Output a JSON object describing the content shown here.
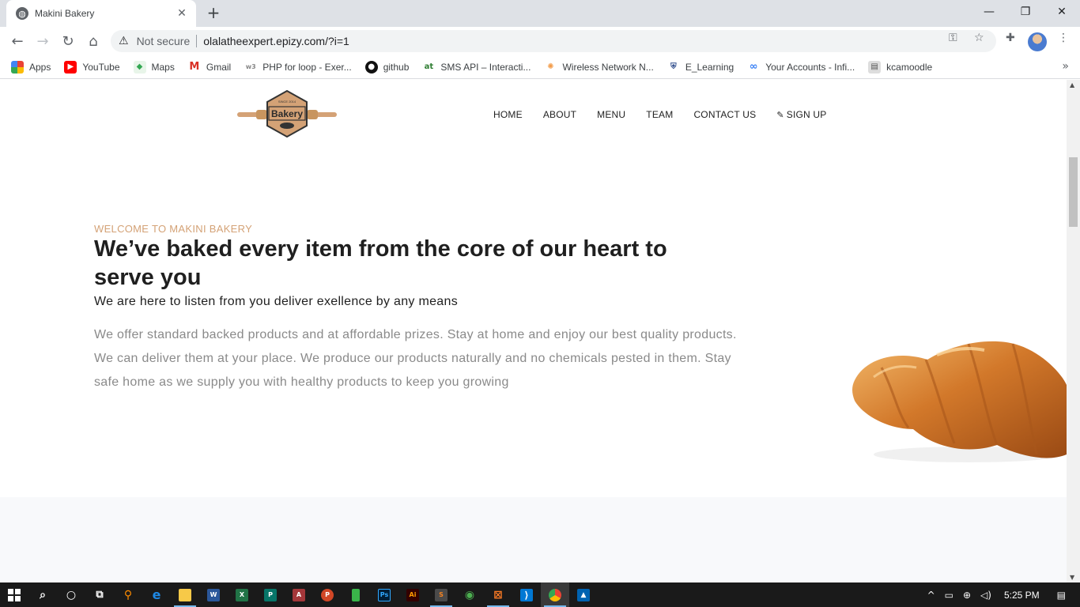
{
  "browser": {
    "tab_title": "Makini Bakery",
    "security_label": "Not secure",
    "url": "olalatheexpert.epizy.com/?i=1",
    "bookmarks": [
      {
        "label": "Apps",
        "icon": "apps-grid-icon",
        "color": "#e8453c"
      },
      {
        "label": "YouTube",
        "icon": "youtube-icon",
        "color": "#ff0000"
      },
      {
        "label": "Maps",
        "icon": "maps-icon",
        "color": "#34a853"
      },
      {
        "label": "Gmail",
        "icon": "gmail-icon",
        "color": "#d93025"
      },
      {
        "label": "PHP for loop - Exer...",
        "icon": "w3schools-icon",
        "color": "#888888"
      },
      {
        "label": "github",
        "icon": "github-icon",
        "color": "#111111"
      },
      {
        "label": "SMS API – Interacti...",
        "icon": "africastalking-icon",
        "color": "#f59c00"
      },
      {
        "label": "Wireless Network N...",
        "icon": "spinner-icon",
        "color": "#f39c4a"
      },
      {
        "label": "E_Learning",
        "icon": "shield-icon",
        "color": "#2c4a8a"
      },
      {
        "label": "Your Accounts - Infi...",
        "icon": "infinity-icon",
        "color": "#3b82f6"
      },
      {
        "label": "kcamoodle",
        "icon": "moodle-icon",
        "color": "#777777"
      }
    ]
  },
  "site": {
    "logo_text": "Bakery",
    "logo_since": "SINCE 2014",
    "nav": [
      "HOME",
      "ABOUT",
      "MENU",
      "TEAM",
      "CONTACT US"
    ],
    "signup_label": "SIGN UP",
    "hero": {
      "welcome": "WELCOME TO MAKINI BAKERY",
      "headline": "We’ve baked every item from the core of our heart to serve you",
      "subline": "We are here to listen from you deliver exellence by any means",
      "body": "We offer standard backed products and at affordable prizes. Stay at home and enjoy our best quality products. We can deliver them at your place. We produce our products naturally and no chemicals pested in them. Stay safe home as we supply you with healthy products to keep you growing"
    },
    "accent_color": "#d4a276"
  },
  "taskbar": {
    "time": "5:25 PM",
    "apps": [
      {
        "name": "search-icon",
        "color": "#1a1a1a",
        "glyph": "⌕"
      },
      {
        "name": "cortana-icon",
        "color": "#1a1a1a",
        "glyph": "○"
      },
      {
        "name": "task-view-icon",
        "color": "#1a1a1a",
        "glyph": "⧉"
      },
      {
        "name": "search-everything-icon",
        "color": "#ff8c00",
        "glyph": "⚲"
      },
      {
        "name": "edge-icon",
        "color": "#1e88e5",
        "glyph": "e"
      },
      {
        "name": "file-explorer-icon",
        "color": "#f7c948",
        "glyph": "▬"
      },
      {
        "name": "word-icon",
        "color": "#2b579a",
        "glyph": "W"
      },
      {
        "name": "excel-icon",
        "color": "#217346",
        "glyph": "X"
      },
      {
        "name": "publisher-icon",
        "color": "#077568",
        "glyph": "P"
      },
      {
        "name": "access-icon",
        "color": "#a4373a",
        "glyph": "A"
      },
      {
        "name": "powerpoint-icon",
        "color": "#d24726",
        "glyph": "P"
      },
      {
        "name": "green-app-icon",
        "color": "#3ab54a",
        "glyph": "▮"
      },
      {
        "name": "photoshop-icon",
        "color": "#001e36",
        "glyph": "Ps"
      },
      {
        "name": "illustrator-icon",
        "color": "#330000",
        "glyph": "Ai"
      },
      {
        "name": "sublime-icon",
        "color": "#f58220",
        "glyph": "S"
      },
      {
        "name": "greenshot-icon",
        "color": "#2e7d32",
        "glyph": "◉"
      },
      {
        "name": "xampp-icon",
        "color": "#fb7a24",
        "glyph": "⊠"
      },
      {
        "name": "vscode-icon",
        "color": "#0078d4",
        "glyph": "⟩"
      },
      {
        "name": "chrome-icon",
        "color": "#4285f4",
        "glyph": "◍"
      },
      {
        "name": "photos-icon",
        "color": "#0063b1",
        "glyph": "▲"
      }
    ]
  }
}
